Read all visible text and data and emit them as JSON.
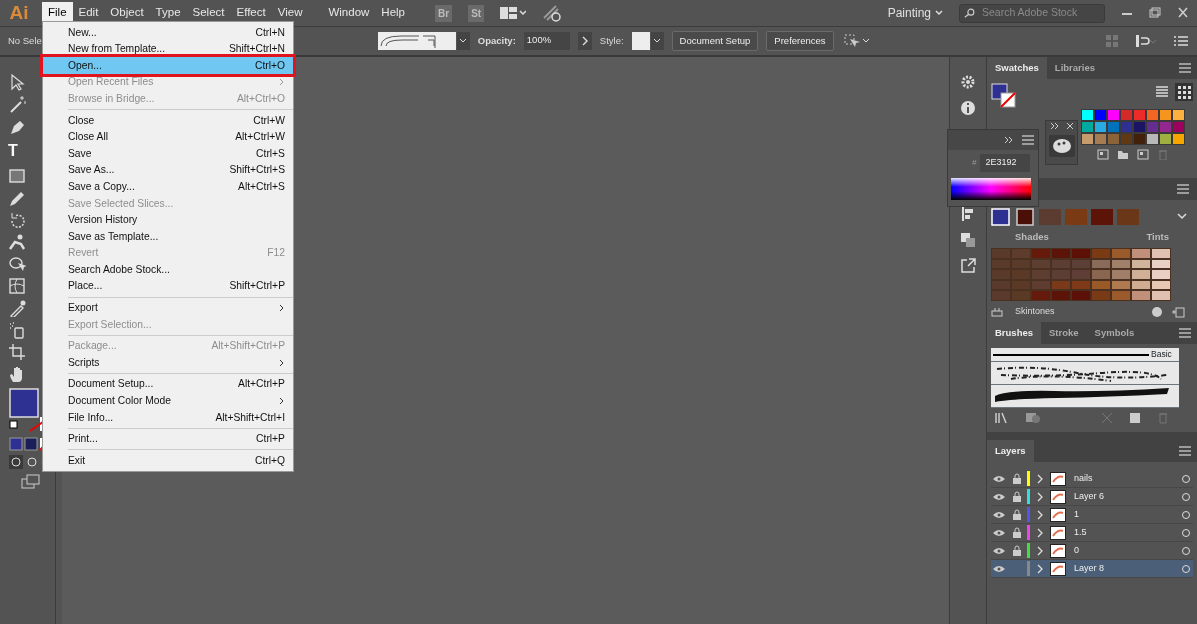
{
  "app": {
    "logo": "Ai"
  },
  "menu_bar": [
    {
      "label": "File",
      "selected": true
    },
    {
      "label": "Edit",
      "selected": false
    },
    {
      "label": "Object",
      "selected": false
    },
    {
      "label": "Type",
      "selected": false
    },
    {
      "label": "Select",
      "selected": false
    },
    {
      "label": "Effect",
      "selected": false
    },
    {
      "label": "View",
      "selected": false
    },
    {
      "label": "Window",
      "selected": false
    },
    {
      "label": "Help",
      "selected": false
    }
  ],
  "bridge_badges": [
    "Br",
    "St"
  ],
  "workspace": {
    "label": "Painting"
  },
  "search": {
    "placeholder": "Search Adobe Stock"
  },
  "control_bar": {
    "selection": "No Sele",
    "opacity_label": "Opacity:",
    "opacity": "100%",
    "style_label": "Style:",
    "buttons": [
      "Document Setup",
      "Preferences"
    ]
  },
  "tools": {
    "type_glyph": "T"
  },
  "file_menu": [
    {
      "kind": "item",
      "label": "New...",
      "shortcut": "Ctrl+N",
      "disabled": false,
      "submenu": false,
      "selected": false
    },
    {
      "kind": "item",
      "label": "New from Template...",
      "shortcut": "Shift+Ctrl+N",
      "disabled": false,
      "submenu": false,
      "selected": false
    },
    {
      "kind": "item",
      "label": "Open...",
      "shortcut": "Ctrl+O",
      "disabled": false,
      "submenu": false,
      "selected": true
    },
    {
      "kind": "item",
      "label": "Open Recent Files",
      "disabled": true,
      "submenu": true,
      "selected": false
    },
    {
      "kind": "item",
      "label": "Browse in Bridge...",
      "shortcut": "Alt+Ctrl+O",
      "disabled": true,
      "submenu": false,
      "selected": false
    },
    {
      "kind": "separator"
    },
    {
      "kind": "item",
      "label": "Close",
      "shortcut": "Ctrl+W",
      "disabled": false,
      "submenu": false,
      "selected": false
    },
    {
      "kind": "item",
      "label": "Close All",
      "shortcut": "Alt+Ctrl+W",
      "disabled": false,
      "submenu": false,
      "selected": false
    },
    {
      "kind": "item",
      "label": "Save",
      "shortcut": "Ctrl+S",
      "disabled": false,
      "submenu": false,
      "selected": false
    },
    {
      "kind": "item",
      "label": "Save As...",
      "shortcut": "Shift+Ctrl+S",
      "disabled": false,
      "submenu": false,
      "selected": false
    },
    {
      "kind": "item",
      "label": "Save a Copy...",
      "shortcut": "Alt+Ctrl+S",
      "disabled": false,
      "submenu": false,
      "selected": false
    },
    {
      "kind": "item",
      "label": "Save Selected Slices...",
      "disabled": true,
      "submenu": false,
      "selected": false
    },
    {
      "kind": "item",
      "label": "Version History",
      "disabled": false,
      "submenu": false,
      "selected": false
    },
    {
      "kind": "item",
      "label": "Save as Template...",
      "disabled": false,
      "submenu": false,
      "selected": false
    },
    {
      "kind": "item",
      "label": "Revert",
      "shortcut": "F12",
      "disabled": true,
      "submenu": false,
      "selected": false
    },
    {
      "kind": "item",
      "label": "Search Adobe Stock...",
      "disabled": false,
      "submenu": false,
      "selected": false
    },
    {
      "kind": "item",
      "label": "Place...",
      "shortcut": "Shift+Ctrl+P",
      "disabled": false,
      "submenu": false,
      "selected": false
    },
    {
      "kind": "separator"
    },
    {
      "kind": "item",
      "label": "Export",
      "disabled": false,
      "submenu": true,
      "selected": false
    },
    {
      "kind": "item",
      "label": "Export Selection...",
      "disabled": true,
      "submenu": false,
      "selected": false
    },
    {
      "kind": "separator"
    },
    {
      "kind": "item",
      "label": "Package...",
      "shortcut": "Alt+Shift+Ctrl+P",
      "disabled": true,
      "submenu": false,
      "selected": false
    },
    {
      "kind": "item",
      "label": "Scripts",
      "disabled": false,
      "submenu": true,
      "selected": false
    },
    {
      "kind": "separator"
    },
    {
      "kind": "item",
      "label": "Document Setup...",
      "shortcut": "Alt+Ctrl+P",
      "disabled": false,
      "submenu": false,
      "selected": false
    },
    {
      "kind": "item",
      "label": "Document Color Mode",
      "disabled": false,
      "submenu": true,
      "selected": false
    },
    {
      "kind": "item",
      "label": "File Info...",
      "shortcut": "Alt+Shift+Ctrl+I",
      "disabled": false,
      "submenu": false,
      "selected": false
    },
    {
      "kind": "separator"
    },
    {
      "kind": "item",
      "label": "Print...",
      "shortcut": "Ctrl+P",
      "disabled": false,
      "submenu": false,
      "selected": false
    },
    {
      "kind": "separator"
    },
    {
      "kind": "item",
      "label": "Exit",
      "shortcut": "Ctrl+Q",
      "disabled": false,
      "submenu": false,
      "selected": false
    }
  ],
  "color_panel": {
    "hex_label": "#",
    "hex": "2E3192"
  },
  "swatches_panel": {
    "tabs": [
      {
        "label": "Swatches",
        "selected": true
      },
      {
        "label": "Libraries",
        "selected": false
      }
    ],
    "swatches": [
      {
        "color": "#00ffff"
      },
      {
        "color": "#0000ff"
      },
      {
        "color": "#ff00ff"
      },
      {
        "color": "#d42a2a"
      },
      {
        "color": "#ee2a2a"
      },
      {
        "color": "#f26522"
      },
      {
        "color": "#f7941d"
      },
      {
        "color": "#fbb040"
      },
      {
        "color": "#00a99d"
      },
      {
        "color": "#29abe2"
      },
      {
        "color": "#0071bc"
      },
      {
        "color": "#2e3192"
      },
      {
        "color": "#1b1464"
      },
      {
        "color": "#662d91"
      },
      {
        "color": "#93278f"
      },
      {
        "color": "#9e005d"
      },
      {
        "color": "#c69c6d"
      },
      {
        "color": "#a67c52"
      },
      {
        "color": "#8c6239"
      },
      {
        "color": "#603813"
      },
      {
        "color": "#42210b"
      },
      {
        "color": "#b8b8b8"
      },
      {
        "color": "#a0b040"
      },
      {
        "color": "#f7a600"
      }
    ]
  },
  "color_guide_panel": {
    "base_colors": [
      {
        "color": "#5c3c30"
      },
      {
        "color": "#7a3a14"
      },
      {
        "color": "#5c1408"
      },
      {
        "color": "#6a3818"
      }
    ],
    "shades_label": "Shades",
    "tints_label": "Tints",
    "library": "Skintones",
    "grid": [
      {
        "color": "#5a3a2a"
      },
      {
        "color": "#5e3c2c"
      },
      {
        "color": "#661a0a"
      },
      {
        "color": "#5c1408"
      },
      {
        "color": "#5c1006"
      },
      {
        "color": "#7a3a14"
      },
      {
        "color": "#9a5a2a"
      },
      {
        "color": "#c0907a"
      },
      {
        "color": "#e0c0b0"
      },
      {
        "color": "#5a3a2b"
      },
      {
        "color": "#5a3a28"
      },
      {
        "color": "#5e3e30"
      },
      {
        "color": "#5c3e34"
      },
      {
        "color": "#5c4038"
      },
      {
        "color": "#8a6a58"
      },
      {
        "color": "#a08068"
      },
      {
        "color": "#d0b49c"
      },
      {
        "color": "#e8d0c4"
      },
      {
        "color": "#5a3a29"
      },
      {
        "color": "#5a3a27"
      },
      {
        "color": "#5e3e31"
      },
      {
        "color": "#5c3e35"
      },
      {
        "color": "#5e3e36"
      },
      {
        "color": "#8a6650"
      },
      {
        "color": "#a07e68"
      },
      {
        "color": "#d0b096"
      },
      {
        "color": "#e8d0c5"
      },
      {
        "color": "#5a3a2c"
      },
      {
        "color": "#5a3a26"
      },
      {
        "color": "#5e3c30"
      },
      {
        "color": "#7a3a1a"
      },
      {
        "color": "#7e3a18"
      },
      {
        "color": "#9a5a28"
      },
      {
        "color": "#b07a50"
      },
      {
        "color": "#d0ac90"
      },
      {
        "color": "#e6c8b4"
      },
      {
        "color": "#5a3a2d"
      },
      {
        "color": "#5a3a25"
      },
      {
        "color": "#661a0b"
      },
      {
        "color": "#5c1409"
      },
      {
        "color": "#5c1007"
      },
      {
        "color": "#7a3a15"
      },
      {
        "color": "#9a5a2b"
      },
      {
        "color": "#c0907b"
      },
      {
        "color": "#e0c0b1"
      }
    ]
  },
  "brushes_panel": {
    "tabs": [
      {
        "label": "Brushes",
        "selected": true
      },
      {
        "label": "Stroke",
        "selected": false
      },
      {
        "label": "Symbols",
        "selected": false
      }
    ],
    "brushes": [
      {
        "kind": "line",
        "name": "Basic"
      },
      {
        "kind": "chalk"
      },
      {
        "kind": "charcoal"
      }
    ]
  },
  "layers_panel": {
    "tabs": [
      {
        "label": "Layers",
        "selected": true
      }
    ],
    "layers": [
      {
        "name": "nails",
        "color": "#ffff00",
        "locked": true,
        "selected": false
      },
      {
        "name": "Layer 6",
        "color": "#33dddd",
        "locked": true,
        "selected": false
      },
      {
        "name": "1",
        "color": "#5555ee",
        "locked": true,
        "selected": false
      },
      {
        "name": "1.5",
        "color": "#ee44ee",
        "locked": true,
        "selected": false
      },
      {
        "name": "0",
        "color": "#44dd44",
        "locked": true,
        "selected": false
      },
      {
        "name": "Layer 8",
        "color": "#888888",
        "locked": false,
        "selected": true
      }
    ]
  }
}
